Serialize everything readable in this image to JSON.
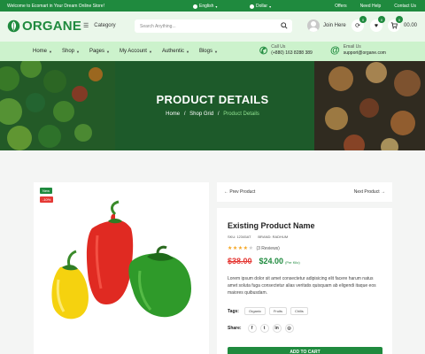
{
  "topbar": {
    "welcome": "Welcome to Ecomart in Your Dream Online Store!",
    "language": "English",
    "currency": "Dollar",
    "links": [
      "Offers",
      "Need Help",
      "Contact Us"
    ]
  },
  "header": {
    "logo": "ORGANE",
    "category_label": "Category",
    "search_placeholder": "Search Anything...",
    "join_label": "Join Here",
    "compare_count": "0",
    "wishlist_count": "0",
    "cart_count": "0",
    "cart_total": "00.00"
  },
  "nav": {
    "items": [
      "Home",
      "Shop",
      "Pages",
      "My Account",
      "Authentic",
      "Blogs"
    ],
    "call_label": "Call Us",
    "call_value": "(+880) 163 8288 389",
    "email_label": "Email Us",
    "email_value": "support@organe.com"
  },
  "banner": {
    "title": "PRODUCT DETAILS",
    "breadcrumb": [
      "Home",
      "Shop Grid",
      "Product Details"
    ],
    "separator": "/"
  },
  "product": {
    "badge_new": "New",
    "badge_discount": "-10%",
    "prev_label": "Prev Product",
    "next_label": "Next Product",
    "name": "Existing Product Name",
    "sku": "SKU: 12345AT",
    "brand": "BRAND: RADHUM",
    "rating": 4,
    "rating_max": 5,
    "reviews": "(3 Reviews)",
    "old_price": "$38.00",
    "new_price": "$24.00",
    "unit": "(Per Kilo)",
    "description": "Lorem ipsum dolor sit amet consectetur adipisicing elit facere harum natus amet soluta fuga consectetur alias veritatis quisquam ab eligendi itaque eos maiores quibusdam.",
    "tags_label": "Tags:",
    "tags": [
      "Organic",
      "Fruits",
      "Chilis"
    ],
    "share_label": "Share:",
    "share_icons": [
      "facebook-icon",
      "twitter-icon",
      "linkedin-icon",
      "instagram-icon"
    ],
    "cart_button": "ADD TO CART"
  },
  "colors": {
    "brand_green": "#1f8a3e",
    "nav_bg": "#ccf2cc",
    "discount_red": "#e53935",
    "star": "#f5a623"
  }
}
